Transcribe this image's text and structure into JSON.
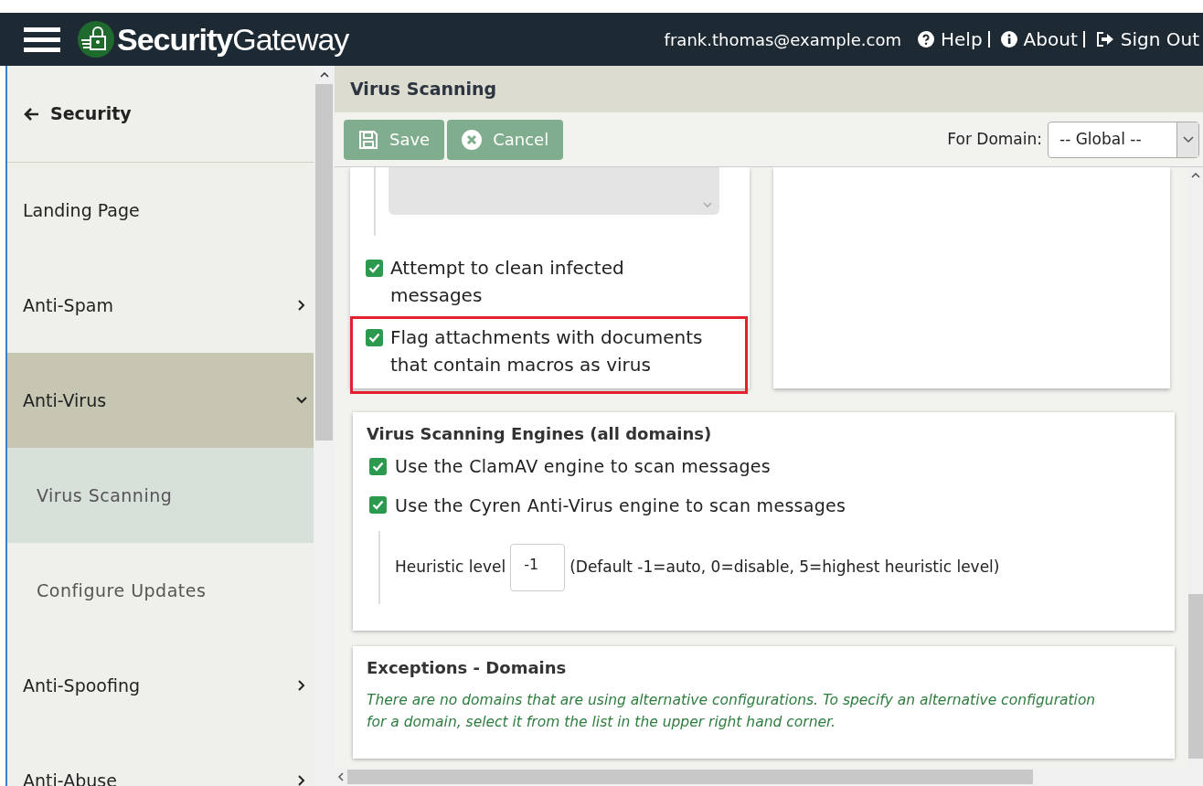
{
  "header": {
    "logo_text": "**Security**Gateway",
    "user": "frank.thomas@example.com",
    "links": [
      {
        "kind": "help",
        "label": "Help"
      },
      {
        "kind": "about",
        "label": "About"
      },
      {
        "kind": "signout",
        "label": "Sign Out"
      }
    ]
  },
  "sidebar": {
    "items": [
      {
        "kind": "back",
        "label": "Security",
        "selected": false
      },
      {
        "kind": "section",
        "label": "Landing Page",
        "selected": false
      },
      {
        "kind": "section",
        "label": "Anti-Spam",
        "selected": false,
        "expanded": false
      },
      {
        "kind": "section",
        "label": "Anti-Virus",
        "selected": true,
        "expanded": true
      },
      {
        "kind": "sub",
        "label": "Virus Scanning",
        "selected": true
      },
      {
        "kind": "sub",
        "label": "Configure Updates",
        "selected": false
      },
      {
        "kind": "section",
        "label": "Anti-Spoofing",
        "selected": false,
        "expanded": false
      },
      {
        "kind": "section",
        "label": "Anti-Abuse",
        "selected": false,
        "expanded": false
      }
    ]
  },
  "page_title": "Virus Scanning",
  "toolbar": {
    "buttons": [
      {
        "kind": "save",
        "label": "Save",
        "disabled": true
      },
      {
        "kind": "cancel",
        "label": "Cancel",
        "disabled": true
      }
    ],
    "domain_label": "For Domain:",
    "domain_value": "-- Global --"
  },
  "options_card": {
    "list_disabled": true,
    "options": [
      {
        "label": "Attempt to clean infected messages",
        "checked": true,
        "highlighted": false
      },
      {
        "label": "Flag attachments with documents that contain macros as virus",
        "checked": true,
        "highlighted": true
      }
    ]
  },
  "engines_card": {
    "title": "Virus Scanning Engines (all domains)",
    "options": [
      {
        "label": "Use the ClamAV engine to scan messages",
        "checked": true
      },
      {
        "label": "Use the Cyren Anti-Virus engine to scan messages",
        "checked": true
      }
    ],
    "heuristic_label": "Heuristic level",
    "heuristic_value": "-1",
    "heuristic_hint": "(Default -1=auto, 0=disable, 5=highest heuristic level)"
  },
  "exceptions_card": {
    "title": "Exceptions - Domains",
    "message": "There are no domains that are using alternative configurations. To specify an alternative configuration for a domain, select it from the list in the upper right hand corner."
  }
}
